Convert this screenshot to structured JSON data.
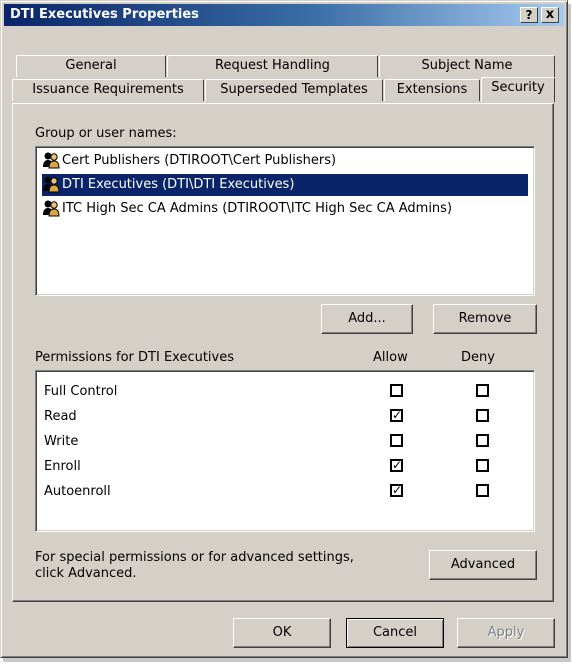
{
  "window": {
    "title": "DTI Executives Properties",
    "help_label": "?",
    "close_label": "x"
  },
  "tabs": {
    "back_row": [
      "General",
      "Request Handling",
      "Subject Name"
    ],
    "front_row": [
      "Issuance Requirements",
      "Superseded Templates",
      "Extensions",
      "Security"
    ],
    "active": "Security"
  },
  "security": {
    "group_label": "Group or user names:",
    "users": [
      {
        "name": "Cert Publishers (DTIROOT\\Cert Publishers)",
        "selected": false
      },
      {
        "name": "DTI Executives (DTI\\DTI Executives)",
        "selected": true
      },
      {
        "name": "ITC High Sec CA Admins (DTIROOT\\ITC High Sec CA Admins)",
        "selected": false
      }
    ],
    "add_label": "Add...",
    "remove_label": "Remove",
    "permissions_label": "Permissions for DTI Executives",
    "allow_header": "Allow",
    "deny_header": "Deny",
    "permissions": [
      {
        "name": "Full Control",
        "allow": false,
        "deny": false
      },
      {
        "name": "Read",
        "allow": true,
        "deny": false
      },
      {
        "name": "Write",
        "allow": false,
        "deny": false
      },
      {
        "name": "Enroll",
        "allow": true,
        "deny": false
      },
      {
        "name": "Autoenroll",
        "allow": true,
        "deny": false
      }
    ],
    "advanced_note_line1": "For special permissions or for advanced settings,",
    "advanced_note_line2": "click Advanced.",
    "advanced_label": "Advanced"
  },
  "footer": {
    "ok_label": "OK",
    "cancel_label": "Cancel",
    "apply_label": "Apply"
  },
  "colors": {
    "title_gradient_start": "#0a246a",
    "selection": "#0a246a",
    "face": "#d4d0c8"
  }
}
